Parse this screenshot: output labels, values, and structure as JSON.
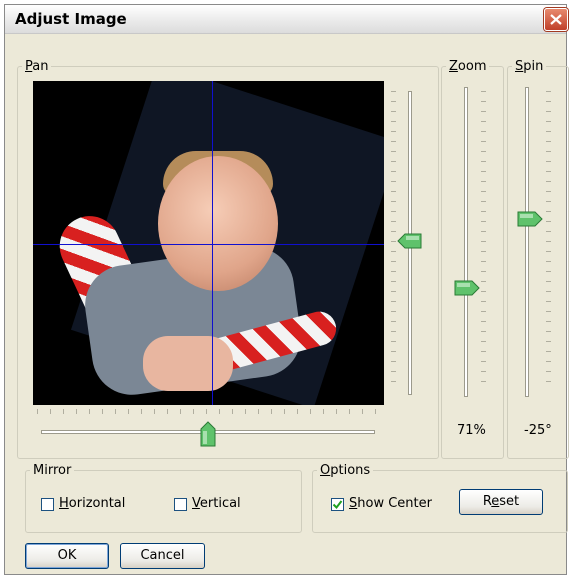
{
  "window": {
    "title": "Adjust Image"
  },
  "pan": {
    "legend_key": "P",
    "legend_rest": "an",
    "horizontal_level": 0.5,
    "vertical_level": 0.5
  },
  "zoom": {
    "legend_key": "Z",
    "legend_rest": "oom",
    "value": "71%",
    "level": 0.71
  },
  "spin": {
    "legend_key": "S",
    "legend_rest": "pin",
    "value": "-25°",
    "degrees": -25
  },
  "mirror": {
    "legend": "Mirror",
    "horizontal": {
      "key": "H",
      "rest": "orizontal",
      "checked": false
    },
    "vertical": {
      "key": "V",
      "rest": "ertical",
      "checked": false
    }
  },
  "options": {
    "legend_key": "O",
    "legend_rest": "ptions",
    "show_center": {
      "key": "S",
      "rest": "how Center",
      "checked": true
    },
    "reset": {
      "pre": "R",
      "key": "e",
      "rest": "set"
    }
  },
  "buttons": {
    "ok": "OK",
    "cancel": "Cancel"
  },
  "icons": {
    "close": "close-icon",
    "check": "checkmark-icon",
    "thumb": "slider-thumb-icon"
  },
  "colors": {
    "crosshair": "#1010d0",
    "thumb": "#3ea34a",
    "close_button": "#c0402a"
  }
}
